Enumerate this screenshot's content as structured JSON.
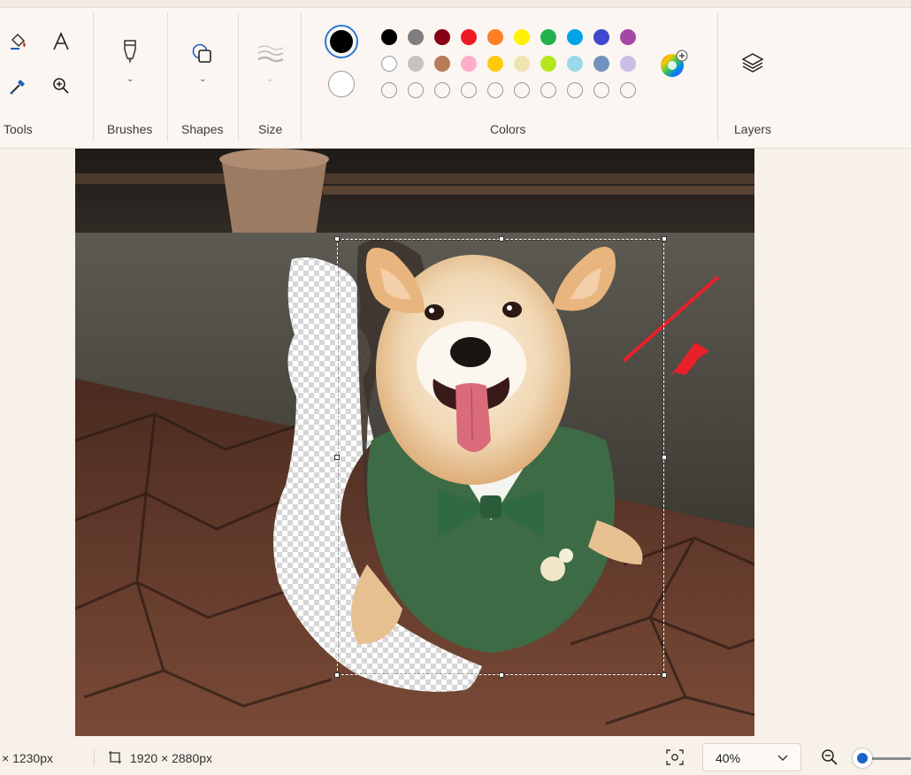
{
  "toolbar": {
    "groups": {
      "tools": "Tools",
      "brushes": "Brushes",
      "shapes": "Shapes",
      "size": "Size",
      "colors": "Colors",
      "layers": "Layers"
    },
    "primary_color": "#000000",
    "secondary_color": "#ffffff",
    "palette_row1": [
      "#000000",
      "#7f7f7f",
      "#880015",
      "#ed1c24",
      "#ff7f27",
      "#fff200",
      "#22b14c",
      "#00a2e8",
      "#3f48cc",
      "#a349a4"
    ],
    "palette_row2": [
      "#ffffff",
      "#c3c3c3",
      "#b97a57",
      "#ffaec9",
      "#ffc90e",
      "#efe4b0",
      "#b5e61d",
      "#99d9ea",
      "#7092be",
      "#c8bfe7"
    ],
    "palette_row3_empty": 10
  },
  "canvas": {
    "image": "corgi-in-green-vest",
    "selection_active": true,
    "annotation_arrow_color": "#e8202a"
  },
  "status": {
    "selection_size": "× 1230px",
    "image_size": "1920 × 2880px",
    "zoom": "40%",
    "zoom_level": 0.05
  }
}
